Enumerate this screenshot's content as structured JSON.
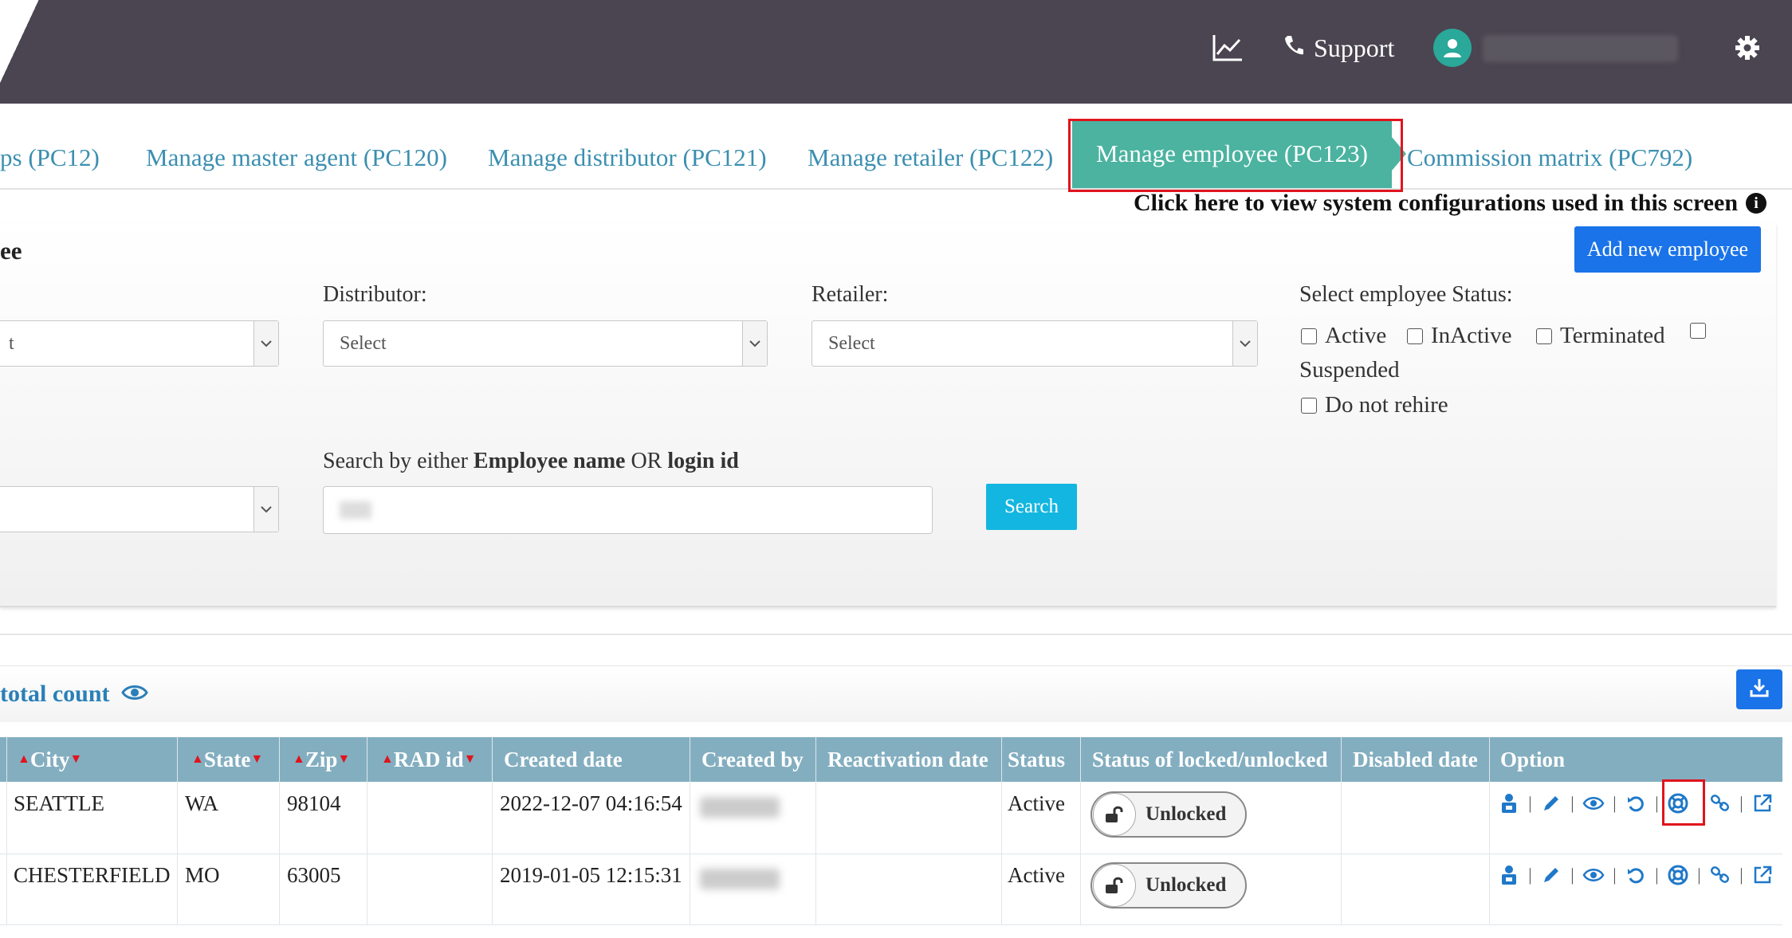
{
  "topbar": {
    "support_label": "Support"
  },
  "tabs": [
    {
      "label": "ps (PC12)"
    },
    {
      "label": "Manage master agent (PC120)"
    },
    {
      "label": "Manage distributor (PC121)"
    },
    {
      "label": "Manage retailer (PC122)"
    },
    {
      "label": "Manage employee (PC123)",
      "active": true
    },
    {
      "label": "Commission matrix (PC792)"
    }
  ],
  "system_config_text": "Click here to view system configurations used in this screen",
  "panel": {
    "title": "ee",
    "add_button": "Add new employee",
    "master_select_value": "t",
    "distributor_label": "Distributor:",
    "distributor_value": "Select",
    "retailer_label": "Retailer:",
    "retailer_value": "Select",
    "status_label": "Select employee Status:",
    "status_options": [
      "Active",
      "InActive",
      "Terminated",
      "Suspended",
      "Do not rehire"
    ],
    "search_label_prefix": "Search by either ",
    "search_label_name": "Employee name",
    "search_label_or": " OR ",
    "search_label_login": "login id",
    "search_button": "Search"
  },
  "results": {
    "count_label": "total count"
  },
  "table": {
    "columns": [
      "City",
      "State",
      "Zip",
      "RAD id",
      "Created date",
      "Created by",
      "Reactivation date",
      "Status",
      "Status of locked/unlocked",
      "Disabled date",
      "Option"
    ],
    "rows": [
      {
        "city": "SEATTLE",
        "state": "WA",
        "zip": "98104",
        "rad": "",
        "created": "2022-12-07 04:16:54",
        "status": "Active",
        "lock": "Unlocked"
      },
      {
        "city": "CHESTERFIELD",
        "state": "MO",
        "zip": "63005",
        "rad": "",
        "created": "2019-01-05 12:15:31",
        "status": "Active",
        "lock": "Unlocked"
      }
    ]
  },
  "colors": {
    "topbar": "#4a4550",
    "active_tab": "#4bb3a0",
    "tab_text": "#3b8fb0",
    "table_header": "#83aec0",
    "primary_button": "#1a73e8",
    "search_button": "#12b6e0",
    "highlight": "#e0141e"
  }
}
